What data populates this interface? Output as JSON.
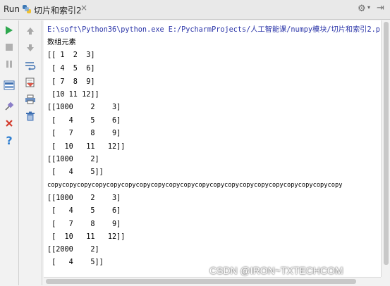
{
  "header": {
    "run_label": "Run",
    "tab_name": "切片和索引2"
  },
  "left_toolbar": {
    "items": [
      "run-icon",
      "stop-icon",
      "pause-icon",
      "layout-icon",
      "pin-icon",
      "close-icon",
      "help-icon"
    ],
    "colors": {
      "run": "#2fa84f",
      "close": "#d33b2c",
      "help": "#2f7fd1"
    }
  },
  "right_toolbar": {
    "items": [
      "arrow-up-icon",
      "arrow-down-icon",
      "soft-wrap-icon",
      "scroll-to-end-icon",
      "print-icon",
      "trash-icon"
    ]
  },
  "console": {
    "lines": [
      "E:\\soft\\Python36\\python.exe E:/PycharmProjects/人工智能课/numpy模块/切片和索引2.p",
      "数组元素",
      "[[ 1  2  3]",
      " [ 4  5  6]",
      " [ 7  8  9]",
      " [10 11 12]]",
      "[[1000    2    3]",
      " [   4    5    6]",
      " [   7    8    9]",
      " [  10   11   12]]",
      "[[1000    2]",
      " [   4    5]]",
      "copycopycopycopycopycopycopycopycopycopycopycopycopycopycopycopycopycopycopycopy",
      "[[1000    2    3]",
      " [   4    5    6]",
      " [   7    8    9]",
      " [  10   11   12]]",
      "[[2000    2]",
      " [   4    5]]"
    ]
  },
  "watermark": "CSDN @IRON~TXTECHCOM"
}
